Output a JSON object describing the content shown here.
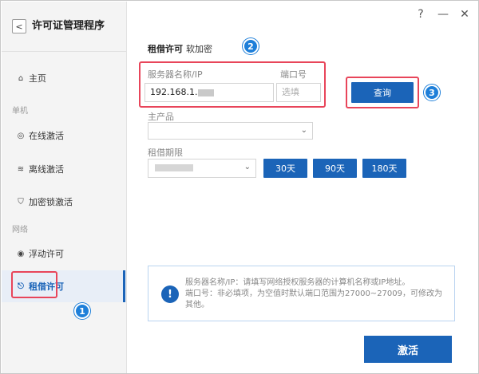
{
  "app": {
    "title": "许可证管理程序"
  },
  "window_controls": {
    "help": "?",
    "minimize": "—",
    "close": "✕"
  },
  "sidebar": {
    "home": "主页",
    "section_single": "单机",
    "online": "在线激活",
    "offline": "离线激活",
    "dongle": "加密锁激活",
    "section_network": "网络",
    "floating": "浮动许可",
    "borrow": "租借许可"
  },
  "main": {
    "tab_title": "租借许可",
    "tab_sub": "软加密",
    "server_label": "服务器名称/IP",
    "server_value": "192.168.1.",
    "port_label": "端口号",
    "port_placeholder": "选填",
    "query_button": "查询",
    "product_label": "主产品",
    "period_label": "租借期限",
    "days_30": "30天",
    "days_90": "90天",
    "days_180": "180天",
    "info_line1": "服务器名称/IP：请填写网络授权服务器的计算机名称或IP地址。",
    "info_line2": "端口号：非必填项，为空值时默认端口范围为27000~27009，可修改为其他。",
    "activate_button": "激活"
  },
  "badges": {
    "b1": "1",
    "b2": "2",
    "b3": "3"
  },
  "icons": {
    "back": "chevron-left-icon",
    "home": "home-icon",
    "online": "globe-icon",
    "offline": "wifi-off-icon",
    "dongle": "shield-icon",
    "floating": "circle-target-icon",
    "borrow": "share-icon",
    "info": "exclamation-icon"
  },
  "colors": {
    "accent": "#1b64b8",
    "highlight": "#e8455a",
    "badge": "#1e7fd9"
  }
}
